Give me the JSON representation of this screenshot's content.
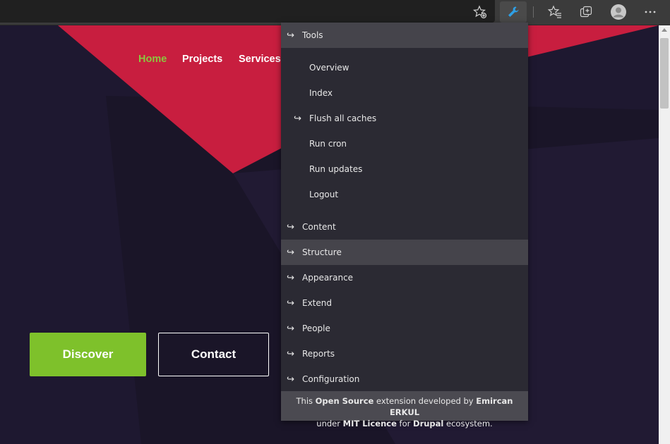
{
  "browser": {
    "toolbar_icons": [
      "favorite-add-icon",
      "wrench-extension-icon",
      "favorites-icon",
      "collections-icon",
      "profile-avatar-icon",
      "more-menu-icon"
    ]
  },
  "site": {
    "nav": {
      "home": "Home",
      "projects": "Projects",
      "services": "Services"
    },
    "buttons": {
      "discover": "Discover",
      "contact": "Contact"
    },
    "colors": {
      "background": "#1e1830",
      "accent_red": "#c81e3f",
      "accent_green": "#7ec12b"
    }
  },
  "menu": {
    "header": "Tools",
    "items": [
      {
        "label": "Overview"
      },
      {
        "label": "Index"
      },
      {
        "label": "Flush all caches"
      },
      {
        "label": "Run cron"
      },
      {
        "label": "Run updates"
      },
      {
        "label": "Logout"
      },
      {
        "label": "Content"
      },
      {
        "label": "Structure"
      },
      {
        "label": "Appearance"
      },
      {
        "label": "Extend"
      },
      {
        "label": "People"
      },
      {
        "label": "Reports"
      },
      {
        "label": "Configuration"
      }
    ],
    "arrow_glyph": "↪",
    "footer": {
      "t1": "This ",
      "b1": "Open Source",
      "t2": " extension developed by ",
      "b2": "Emircan ERKUL",
      "t3": "under ",
      "b3": "MIT Licence",
      "t4": " for ",
      "b4": "Drupal",
      "t5": " ecosystem."
    }
  }
}
